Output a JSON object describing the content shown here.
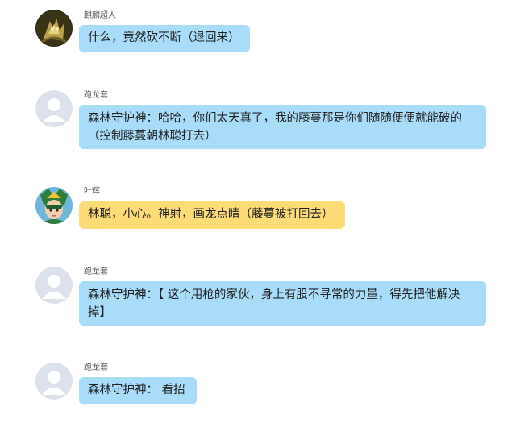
{
  "messages": [
    {
      "sender": "麒麟超人",
      "text": "什么，竟然砍不断（退回来）",
      "avatar": "kirin-ultraman-avatar",
      "bubble_color": "#a9dcf9"
    },
    {
      "sender": "跑龙套",
      "text": "森林守护神：哈哈，你们太天真了，我的藤蔓那是你们随随便便就能破的（控制藤蔓朝林聪打去）",
      "avatar": "default-user-avatar",
      "bubble_color": "#a9dcf9"
    },
    {
      "sender": "叶辉",
      "text": "林聪，小心。神射，画龙点睛（藤蔓被打回去）",
      "avatar": "hero-character-avatar",
      "bubble_color": "#fddc78"
    },
    {
      "sender": "跑龙套",
      "text": "森林守护神：【 这个用枪的家伙，身上有股不寻常的力量，得先把他解决掉】",
      "avatar": "default-user-avatar",
      "bubble_color": "#a9dcf9"
    },
    {
      "sender": "跑龙套",
      "text": "森林守护神： 看招",
      "avatar": "default-user-avatar",
      "bubble_color": "#a9dcf9"
    }
  ]
}
